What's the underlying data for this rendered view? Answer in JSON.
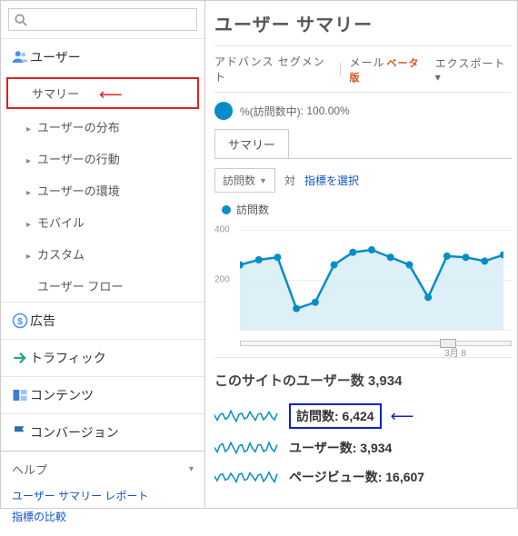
{
  "search": {
    "placeholder": ""
  },
  "sidebar": {
    "users": {
      "label": "ユーザー",
      "items": [
        {
          "label": "サマリー",
          "has_caret": false,
          "highlight": true
        },
        {
          "label": "ユーザーの分布",
          "has_caret": true
        },
        {
          "label": "ユーザーの行動",
          "has_caret": true
        },
        {
          "label": "ユーザーの環境",
          "has_caret": true
        },
        {
          "label": "モバイル",
          "has_caret": true
        },
        {
          "label": "カスタム",
          "has_caret": true
        },
        {
          "label": "ユーザー フロー",
          "has_caret": false
        }
      ]
    },
    "sections": [
      {
        "icon": "dollar",
        "label": "広告",
        "color": "#4b8df8"
      },
      {
        "icon": "arrow",
        "label": "トラフィック",
        "color": "#2aa38b"
      },
      {
        "icon": "blocks",
        "label": "コンテンツ",
        "color": "#3b7dd8"
      },
      {
        "icon": "flag",
        "label": "コンバージョン",
        "color": "#2a6fb0"
      }
    ],
    "help": {
      "title": "ヘルプ",
      "links": [
        "ユーザー サマリー レポート",
        "指標の比較"
      ]
    }
  },
  "main": {
    "title": "ユーザー サマリー",
    "toolbar": {
      "adv_segment": "アドバンス セグメント",
      "mail": "メール",
      "beta": "ベータ版",
      "export": "エクスポート ▾"
    },
    "percent": {
      "label": "%(訪問数中)",
      "value": ": 100.00%"
    },
    "tab_label": "サマリー",
    "controls": {
      "metric_dd": "訪問数",
      "vs": "対",
      "select_metric": "指標を選択"
    },
    "legend_label": "訪問数",
    "chart_data": {
      "type": "line",
      "ylim": [
        0,
        400
      ],
      "yticks": [
        200,
        400
      ],
      "xticks": [
        "3月 8"
      ],
      "values": [
        260,
        280,
        290,
        85,
        110,
        260,
        310,
        320,
        290,
        260,
        130,
        295,
        290,
        275,
        300
      ]
    },
    "site_users": {
      "label": "このサイトのユーザー数",
      "value": "3,934"
    },
    "metrics": [
      {
        "label": "訪問数",
        "value": "6,424",
        "highlight": true
      },
      {
        "label": "ユーザー数",
        "value": "3,934"
      },
      {
        "label": "ページビュー数",
        "value": "16,607"
      }
    ]
  }
}
